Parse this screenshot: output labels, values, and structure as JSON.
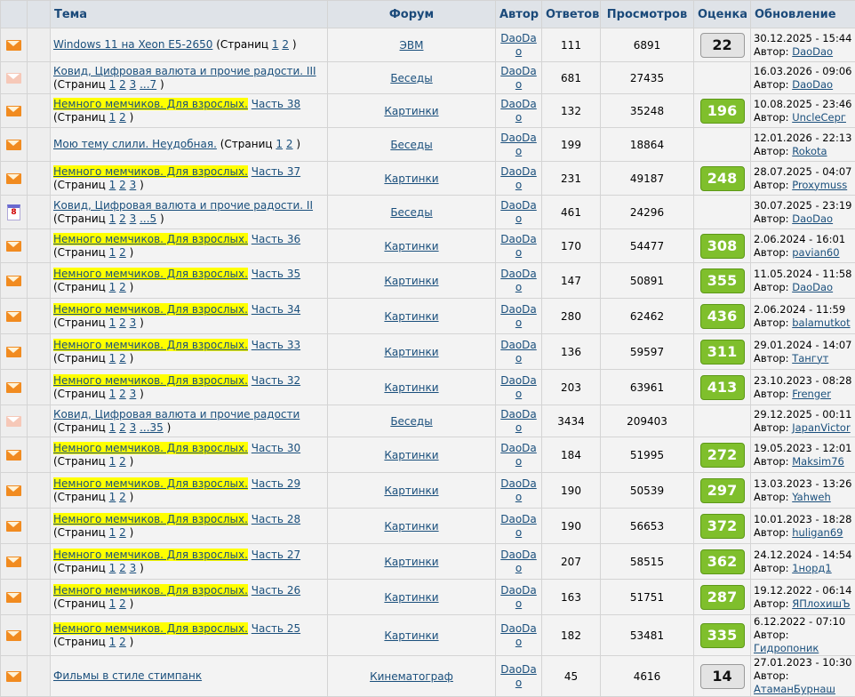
{
  "header": {
    "topic": "Тема",
    "forum": "Форум",
    "author": "Автор",
    "replies": "Ответов",
    "views": "Просмотров",
    "rating": "Оценка",
    "updated": "Обновление"
  },
  "colors": {
    "link": "#1a4f7c",
    "highlight": "#ffff00",
    "rating_green": "#7fbf2c",
    "rating_gray": "#e3e3e3",
    "icon_orange": "#f18b20"
  },
  "rows": [
    {
      "icon": "envelope-icon",
      "hl": "",
      "title": "Windows 11 на Xeon E5-2650",
      "pages_label": "(Страниц",
      "pages": [
        "1",
        "2"
      ],
      "pages_close": ")",
      "forum": "ЭВМ",
      "author": "DaoDao",
      "replies": "111",
      "views": "6891",
      "rating": "22",
      "rating_style": "gray",
      "date": "30.12.2025 - 15:44",
      "by_label": "Автор:",
      "by": "DaoDao"
    },
    {
      "icon": "envelope-pale-icon",
      "hl": "",
      "title": "Ковид, Цифровая валюта и прочие радости. III",
      "pages_label": "(Страниц",
      "pages": [
        "1",
        "2",
        "3",
        "...7"
      ],
      "pages_close": ")",
      "forum": "Беседы",
      "author": "DaoDao",
      "replies": "681",
      "views": "27435",
      "rating": "",
      "rating_style": "none",
      "date": "16.03.2026 - 09:06",
      "by_label": "Автор:",
      "by": "DaoDao"
    },
    {
      "icon": "envelope-icon",
      "hl": "Немного мемчиков. Для взрослых.",
      "title": "Часть 38",
      "pages_label": "(Страниц",
      "pages": [
        "1",
        "2"
      ],
      "pages_close": ")",
      "forum": "Картинки",
      "author": "DaoDao",
      "replies": "132",
      "views": "35248",
      "rating": "196",
      "rating_style": "green",
      "date": "10.08.2025 - 23:46",
      "by_label": "Автор:",
      "by": "UncleСерг"
    },
    {
      "icon": "envelope-icon",
      "hl": "",
      "title": "Мою тему слили. Неудобная.",
      "pages_label": "(Страниц",
      "pages": [
        "1",
        "2"
      ],
      "pages_close": ")",
      "forum": "Беседы",
      "author": "DaoDao",
      "replies": "199",
      "views": "18864",
      "rating": "",
      "rating_style": "none",
      "date": "12.01.2026 - 22:13",
      "by_label": "Автор:",
      "by": "Rokota"
    },
    {
      "icon": "envelope-icon",
      "hl": "Немного мемчиков. Для взрослых.",
      "title": "Часть 37",
      "pages_label": "(Страниц",
      "pages": [
        "1",
        "2",
        "3"
      ],
      "pages_close": ")",
      "forum": "Картинки",
      "author": "DaoDao",
      "replies": "231",
      "views": "49187",
      "rating": "248",
      "rating_style": "green",
      "date": "28.07.2025 - 04:07",
      "by_label": "Автор:",
      "by": "Proxymuss"
    },
    {
      "icon": "calendar-icon",
      "cal": "8",
      "hl": "",
      "title": "Ковид, Цифровая валюта и прочие радости. II",
      "pages_label": "(Страниц",
      "pages": [
        "1",
        "2",
        "3",
        "...5"
      ],
      "pages_close": ")",
      "forum": "Беседы",
      "author": "DaoDao",
      "replies": "461",
      "views": "24296",
      "rating": "",
      "rating_style": "none",
      "date": "30.07.2025 - 23:19",
      "by_label": "Автор:",
      "by": "DaoDao"
    },
    {
      "icon": "envelope-icon",
      "hl": "Немного мемчиков. Для взрослых.",
      "title": "Часть 36",
      "pages_label": "(Страниц",
      "pages": [
        "1",
        "2"
      ],
      "pages_close": ")",
      "forum": "Картинки",
      "author": "DaoDao",
      "replies": "170",
      "views": "54477",
      "rating": "308",
      "rating_style": "green",
      "date": "2.06.2024 - 16:01",
      "by_label": "Автор:",
      "by": "pavian60"
    },
    {
      "icon": "envelope-icon",
      "hl": "Немного мемчиков. Для взрослых.",
      "title": "Часть 35",
      "pages_label": "(Страниц",
      "pages": [
        "1",
        "2"
      ],
      "pages_close": ")",
      "forum": "Картинки",
      "author": "DaoDao",
      "replies": "147",
      "views": "50891",
      "rating": "355",
      "rating_style": "green",
      "date": "11.05.2024 - 11:58",
      "by_label": "Автор:",
      "by": "DaoDao"
    },
    {
      "icon": "envelope-icon",
      "hl": "Немного мемчиков. Для взрослых.",
      "title": "Часть 34",
      "pages_label": "(Страниц",
      "pages": [
        "1",
        "2",
        "3"
      ],
      "pages_close": ")",
      "forum": "Картинки",
      "author": "DaoDao",
      "replies": "280",
      "views": "62462",
      "rating": "436",
      "rating_style": "green",
      "date": "2.06.2024 - 11:59",
      "by_label": "Автор:",
      "by": "balamutkot"
    },
    {
      "icon": "envelope-icon",
      "hl": "Немного мемчиков. Для взрослых.",
      "title": "Часть 33",
      "pages_label": "(Страниц",
      "pages": [
        "1",
        "2"
      ],
      "pages_close": ")",
      "forum": "Картинки",
      "author": "DaoDao",
      "replies": "136",
      "views": "59597",
      "rating": "311",
      "rating_style": "green",
      "date": "29.01.2024 - 14:07",
      "by_label": "Автор:",
      "by": "Тангут"
    },
    {
      "icon": "envelope-icon",
      "hl": "Немного мемчиков. Для взрослых.",
      "title": "Часть 32",
      "pages_label": "(Страниц",
      "pages": [
        "1",
        "2",
        "3"
      ],
      "pages_close": ")",
      "forum": "Картинки",
      "author": "DaoDao",
      "replies": "203",
      "views": "63961",
      "rating": "413",
      "rating_style": "green",
      "date": "23.10.2023 - 08:28",
      "by_label": "Автор:",
      "by": "Frenger"
    },
    {
      "icon": "envelope-pale-icon",
      "hl": "",
      "title": "Ковид, Цифровая валюта и прочие радости",
      "pages_label": "(Страниц",
      "pages": [
        "1",
        "2",
        "3",
        "...35"
      ],
      "pages_close": ")",
      "forum": "Беседы",
      "author": "DaoDao",
      "replies": "3434",
      "views": "209403",
      "rating": "",
      "rating_style": "none",
      "date": "29.12.2025 - 00:11",
      "by_label": "Автор:",
      "by": "JapanVictor"
    },
    {
      "icon": "envelope-icon",
      "hl": "Немного мемчиков. Для взрослых.",
      "title": "Часть 30",
      "pages_label": "(Страниц",
      "pages": [
        "1",
        "2"
      ],
      "pages_close": ")",
      "forum": "Картинки",
      "author": "DaoDao",
      "replies": "184",
      "views": "51995",
      "rating": "272",
      "rating_style": "green",
      "date": "19.05.2023 - 12:01",
      "by_label": "Автор:",
      "by": "Maksim76"
    },
    {
      "icon": "envelope-icon",
      "hl": "Немного мемчиков. Для взрослых.",
      "title": "Часть 29",
      "pages_label": "(Страниц",
      "pages": [
        "1",
        "2"
      ],
      "pages_close": ")",
      "forum": "Картинки",
      "author": "DaoDao",
      "replies": "190",
      "views": "50539",
      "rating": "297",
      "rating_style": "green",
      "date": "13.03.2023 - 13:26",
      "by_label": "Автор:",
      "by": "Yahweh"
    },
    {
      "icon": "envelope-icon",
      "hl": "Немного мемчиков. Для взрослых.",
      "title": "Часть 28",
      "pages_label": "(Страниц",
      "pages": [
        "1",
        "2"
      ],
      "pages_close": ")",
      "forum": "Картинки",
      "author": "DaoDao",
      "replies": "190",
      "views": "56653",
      "rating": "372",
      "rating_style": "green",
      "date": "10.01.2023 - 18:28",
      "by_label": "Автор:",
      "by": "huligan69"
    },
    {
      "icon": "envelope-icon",
      "hl": "Немного мемчиков. Для взрослых.",
      "title": "Часть 27",
      "pages_label": "(Страниц",
      "pages": [
        "1",
        "2",
        "3"
      ],
      "pages_close": ")",
      "forum": "Картинки",
      "author": "DaoDao",
      "replies": "207",
      "views": "58515",
      "rating": "362",
      "rating_style": "green",
      "date": "24.12.2024 - 14:54",
      "by_label": "Автор:",
      "by": "1норд1"
    },
    {
      "icon": "envelope-icon",
      "hl": "Немного мемчиков. Для взрослых.",
      "title": "Часть 26",
      "pages_label": "(Страниц",
      "pages": [
        "1",
        "2"
      ],
      "pages_close": ")",
      "forum": "Картинки",
      "author": "DaoDao",
      "replies": "163",
      "views": "51751",
      "rating": "287",
      "rating_style": "green",
      "date": "19.12.2022 - 06:14",
      "by_label": "Автор:",
      "by": "ЯПлохишЪ"
    },
    {
      "icon": "envelope-icon",
      "hl": "Немного мемчиков. Для взрослых.",
      "title": "Часть 25",
      "pages_label": "(Страниц",
      "pages": [
        "1",
        "2"
      ],
      "pages_close": ")",
      "forum": "Картинки",
      "author": "DaoDao",
      "replies": "182",
      "views": "53481",
      "rating": "335",
      "rating_style": "green",
      "date": "6.12.2022 - 07:10",
      "by_label": "Автор:",
      "by": "Гидропоник"
    },
    {
      "icon": "envelope-icon",
      "hl": "",
      "title": "Фильмы в стиле стимпанк",
      "pages_label": "",
      "pages": [],
      "pages_close": "",
      "forum": "Кинематограф",
      "author": "DaoDao",
      "replies": "45",
      "views": "4616",
      "rating": "14",
      "rating_style": "gray",
      "date": "27.01.2023 - 10:30",
      "by_label": "Автор:",
      "by": "АтаманБурнаш"
    }
  ]
}
